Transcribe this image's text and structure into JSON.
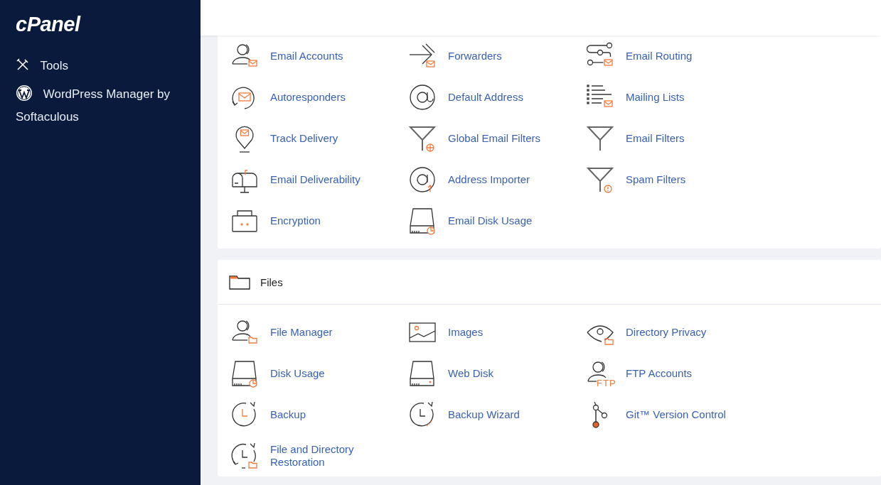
{
  "sidebar": {
    "logo": "cPanel",
    "items": [
      {
        "label": "Tools",
        "kind": "tools"
      },
      {
        "label": "WordPress Manager by Softaculous",
        "kind": "wordpress"
      }
    ]
  },
  "sections": [
    {
      "items": [
        {
          "label": "Email Accounts",
          "kind": "usermail"
        },
        {
          "label": "Forwarders",
          "kind": "forward"
        },
        {
          "label": "Email Routing",
          "kind": "routing"
        },
        {
          "label": "Autoresponders",
          "kind": "responder"
        },
        {
          "label": "Default Address",
          "kind": "at"
        },
        {
          "label": "Mailing Lists",
          "kind": "list"
        },
        {
          "label": "Track Delivery",
          "kind": "pin"
        },
        {
          "label": "Global Email Filters",
          "kind": "globefilter"
        },
        {
          "label": "Email Filters",
          "kind": "filter"
        },
        {
          "label": "Email Deliverability",
          "kind": "mailbox"
        },
        {
          "label": "Address Importer",
          "kind": "atimport"
        },
        {
          "label": "Spam Filters",
          "kind": "alertfilter"
        },
        {
          "label": "Encryption",
          "kind": "lockbox"
        },
        {
          "label": "Email Disk Usage",
          "kind": "diskchart"
        }
      ]
    },
    {
      "title": "Files",
      "items": [
        {
          "label": "File Manager",
          "kind": "userfolder"
        },
        {
          "label": "Images",
          "kind": "image"
        },
        {
          "label": "Directory Privacy",
          "kind": "eye"
        },
        {
          "label": "Disk Usage",
          "kind": "diskchart"
        },
        {
          "label": "Web Disk",
          "kind": "disk"
        },
        {
          "label": "FTP Accounts",
          "kind": "ftpuser",
          "icon_text": "FTP"
        },
        {
          "label": "Backup",
          "kind": "clock"
        },
        {
          "label": "Backup Wizard",
          "kind": "clockwand"
        },
        {
          "label": "Git™ Version Control",
          "kind": "git"
        },
        {
          "label": "File and Directory Restoration",
          "kind": "restore"
        }
      ]
    }
  ]
}
